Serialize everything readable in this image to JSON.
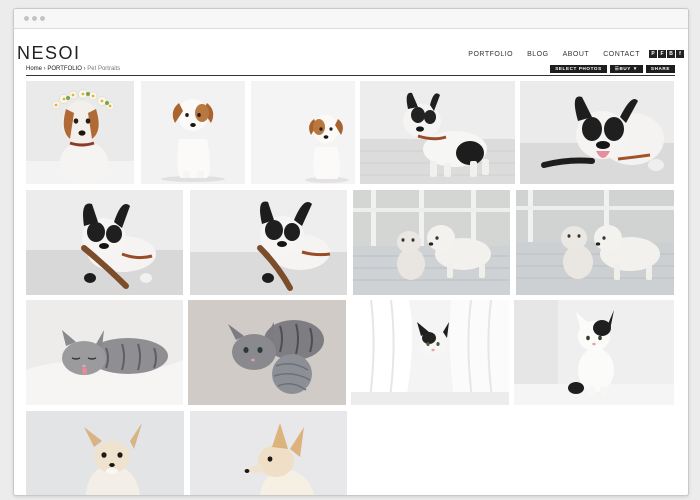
{
  "site": {
    "logo": "NESOI"
  },
  "nav": {
    "items": [
      "PORTFOLIO",
      "BLOG",
      "ABOUT",
      "CONTACT"
    ]
  },
  "social": {
    "icons": [
      "P",
      "F",
      "B",
      "f"
    ]
  },
  "breadcrumb": {
    "home": "Home",
    "sep": " › ",
    "portfolio": "PORTFOLIO",
    "current": "Pet Portraits"
  },
  "actions": {
    "select": "SELECT PHOTOS",
    "buy": "☰BUY ▼",
    "share": "SHARE"
  },
  "colors": {
    "accent": "#1e1e1e",
    "page": "#ffffff",
    "frame": "#ececec"
  }
}
